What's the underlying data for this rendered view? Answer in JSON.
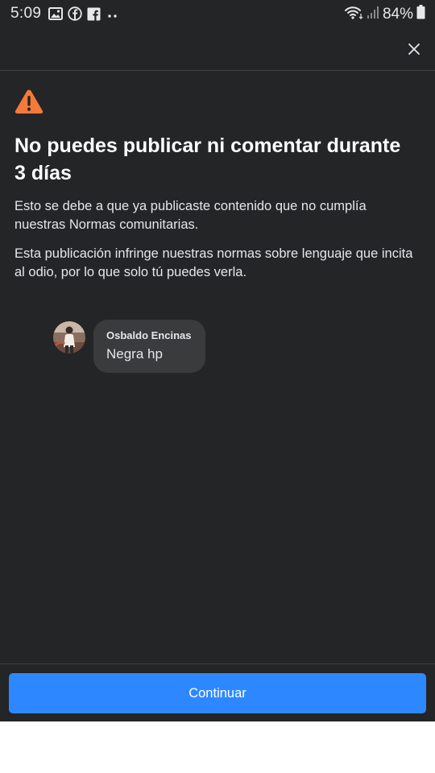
{
  "status_bar": {
    "time": "5:09",
    "left_icons": [
      "gallery-icon",
      "facebook-circle-icon",
      "facebook-square-icon",
      "more-dots-icon"
    ],
    "right_icons": [
      "wifi-icon",
      "signal-icon",
      "battery-icon"
    ],
    "battery": "84%"
  },
  "notice": {
    "title": "No puedes publicar ni comentar durante 3 días",
    "paragraph1": "Esto se debe a que ya publicaste contenido que no cumplía nuestras Normas comunitarias.",
    "paragraph2": "Esta publicación infringe nuestras normas sobre lenguaje que incita al odio, por lo que solo tú puedes verla."
  },
  "comment": {
    "author": "Osbaldo Encinas",
    "text": "Negra hp"
  },
  "footer": {
    "continue_label": "Continuar"
  },
  "colors": {
    "background": "#242527",
    "accent": "#2d88ff",
    "warning": "#f5793a",
    "bubble": "#3a3b3c"
  }
}
